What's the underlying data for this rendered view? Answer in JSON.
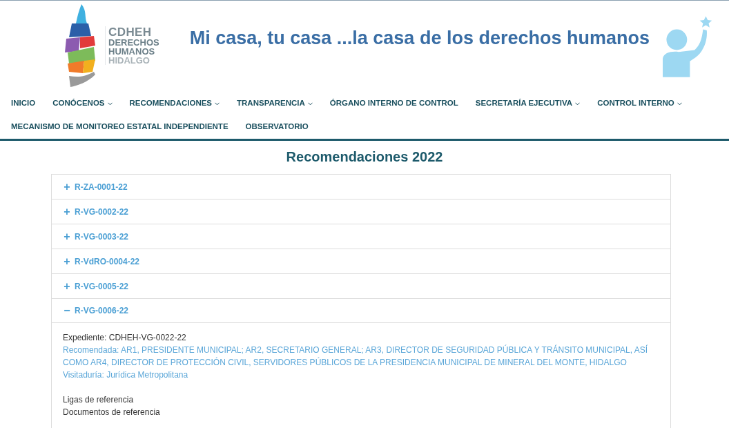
{
  "header": {
    "logo": {
      "acronym": "CDHEH",
      "lines": [
        "DERECHOS",
        "HUMANOS",
        "HIDALGO"
      ]
    },
    "tagline": "Mi casa, tu casa ...la casa de los derechos humanos"
  },
  "nav": [
    {
      "label": "INICIO",
      "has_menu": false
    },
    {
      "label": "CONÓCENOS",
      "has_menu": true
    },
    {
      "label": "RECOMENDACIONES",
      "has_menu": true
    },
    {
      "label": "TRANSPARENCIA",
      "has_menu": true
    },
    {
      "label": "ÓRGANO INTERNO DE CONTROL",
      "has_menu": false
    },
    {
      "label": "SECRETARÍA EJECUTIVA",
      "has_menu": true
    },
    {
      "label": "CONTROL INTERNO",
      "has_menu": true
    },
    {
      "label": "MECANISMO DE MONITOREO ESTATAL INDEPENDIENTE",
      "has_menu": false
    },
    {
      "label": "OBSERVATORIO",
      "has_menu": false
    }
  ],
  "page_title": "Recomendaciones 2022",
  "accordion": [
    {
      "title": "R-ZA-0001-22",
      "expanded": false
    },
    {
      "title": "R-VG-0002-22",
      "expanded": false
    },
    {
      "title": "R-VG-0003-22",
      "expanded": false
    },
    {
      "title": "R-VdRO-0004-22",
      "expanded": false
    },
    {
      "title": "R-VG-0005-22",
      "expanded": false
    },
    {
      "title": "R-VG-0006-22",
      "expanded": true,
      "toggle_open": "−",
      "body": [
        {
          "kind": "plain",
          "text": "Expediente: CDHEH-VG-0022-22"
        },
        {
          "kind": "accent",
          "text": "Recomendada: AR1, PRESIDENTE MUNICIPAL; AR2, SECRETARIO GENERAL; AR3, DIRECTOR DE SEGURIDAD PÚBLICA Y TRÁNSITO MUNICIPAL, ASÍ COMO AR4, DIRECTOR DE PROTECCIÓN CIVIL, SERVIDORES PÚBLICOS DE LA PRESIDENCIA MUNICIPAL DE MINERAL DEL MONTE, HIDALGO"
        },
        {
          "kind": "accent",
          "text": "Visitaduría: Jurídica Metropolitana"
        },
        {
          "kind": "gap"
        },
        {
          "kind": "plain",
          "text": "Ligas de referencia"
        },
        {
          "kind": "plain",
          "text": "Documentos de referencia"
        }
      ]
    }
  ],
  "toggle_closed": "+"
}
